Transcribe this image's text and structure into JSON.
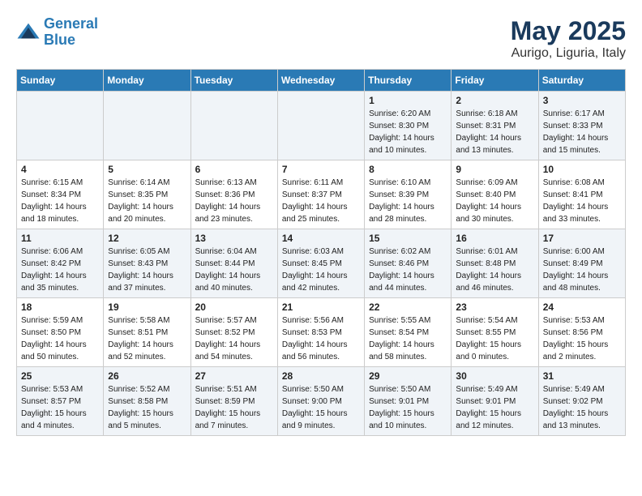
{
  "header": {
    "logo_line1": "General",
    "logo_line2": "Blue",
    "title": "May 2025",
    "subtitle": "Aurigo, Liguria, Italy"
  },
  "days_of_week": [
    "Sunday",
    "Monday",
    "Tuesday",
    "Wednesday",
    "Thursday",
    "Friday",
    "Saturday"
  ],
  "weeks": [
    [
      {
        "day": "",
        "info": ""
      },
      {
        "day": "",
        "info": ""
      },
      {
        "day": "",
        "info": ""
      },
      {
        "day": "",
        "info": ""
      },
      {
        "day": "1",
        "info": "Sunrise: 6:20 AM\nSunset: 8:30 PM\nDaylight: 14 hours\nand 10 minutes."
      },
      {
        "day": "2",
        "info": "Sunrise: 6:18 AM\nSunset: 8:31 PM\nDaylight: 14 hours\nand 13 minutes."
      },
      {
        "day": "3",
        "info": "Sunrise: 6:17 AM\nSunset: 8:33 PM\nDaylight: 14 hours\nand 15 minutes."
      }
    ],
    [
      {
        "day": "4",
        "info": "Sunrise: 6:15 AM\nSunset: 8:34 PM\nDaylight: 14 hours\nand 18 minutes."
      },
      {
        "day": "5",
        "info": "Sunrise: 6:14 AM\nSunset: 8:35 PM\nDaylight: 14 hours\nand 20 minutes."
      },
      {
        "day": "6",
        "info": "Sunrise: 6:13 AM\nSunset: 8:36 PM\nDaylight: 14 hours\nand 23 minutes."
      },
      {
        "day": "7",
        "info": "Sunrise: 6:11 AM\nSunset: 8:37 PM\nDaylight: 14 hours\nand 25 minutes."
      },
      {
        "day": "8",
        "info": "Sunrise: 6:10 AM\nSunset: 8:39 PM\nDaylight: 14 hours\nand 28 minutes."
      },
      {
        "day": "9",
        "info": "Sunrise: 6:09 AM\nSunset: 8:40 PM\nDaylight: 14 hours\nand 30 minutes."
      },
      {
        "day": "10",
        "info": "Sunrise: 6:08 AM\nSunset: 8:41 PM\nDaylight: 14 hours\nand 33 minutes."
      }
    ],
    [
      {
        "day": "11",
        "info": "Sunrise: 6:06 AM\nSunset: 8:42 PM\nDaylight: 14 hours\nand 35 minutes."
      },
      {
        "day": "12",
        "info": "Sunrise: 6:05 AM\nSunset: 8:43 PM\nDaylight: 14 hours\nand 37 minutes."
      },
      {
        "day": "13",
        "info": "Sunrise: 6:04 AM\nSunset: 8:44 PM\nDaylight: 14 hours\nand 40 minutes."
      },
      {
        "day": "14",
        "info": "Sunrise: 6:03 AM\nSunset: 8:45 PM\nDaylight: 14 hours\nand 42 minutes."
      },
      {
        "day": "15",
        "info": "Sunrise: 6:02 AM\nSunset: 8:46 PM\nDaylight: 14 hours\nand 44 minutes."
      },
      {
        "day": "16",
        "info": "Sunrise: 6:01 AM\nSunset: 8:48 PM\nDaylight: 14 hours\nand 46 minutes."
      },
      {
        "day": "17",
        "info": "Sunrise: 6:00 AM\nSunset: 8:49 PM\nDaylight: 14 hours\nand 48 minutes."
      }
    ],
    [
      {
        "day": "18",
        "info": "Sunrise: 5:59 AM\nSunset: 8:50 PM\nDaylight: 14 hours\nand 50 minutes."
      },
      {
        "day": "19",
        "info": "Sunrise: 5:58 AM\nSunset: 8:51 PM\nDaylight: 14 hours\nand 52 minutes."
      },
      {
        "day": "20",
        "info": "Sunrise: 5:57 AM\nSunset: 8:52 PM\nDaylight: 14 hours\nand 54 minutes."
      },
      {
        "day": "21",
        "info": "Sunrise: 5:56 AM\nSunset: 8:53 PM\nDaylight: 14 hours\nand 56 minutes."
      },
      {
        "day": "22",
        "info": "Sunrise: 5:55 AM\nSunset: 8:54 PM\nDaylight: 14 hours\nand 58 minutes."
      },
      {
        "day": "23",
        "info": "Sunrise: 5:54 AM\nSunset: 8:55 PM\nDaylight: 15 hours\nand 0 minutes."
      },
      {
        "day": "24",
        "info": "Sunrise: 5:53 AM\nSunset: 8:56 PM\nDaylight: 15 hours\nand 2 minutes."
      }
    ],
    [
      {
        "day": "25",
        "info": "Sunrise: 5:53 AM\nSunset: 8:57 PM\nDaylight: 15 hours\nand 4 minutes."
      },
      {
        "day": "26",
        "info": "Sunrise: 5:52 AM\nSunset: 8:58 PM\nDaylight: 15 hours\nand 5 minutes."
      },
      {
        "day": "27",
        "info": "Sunrise: 5:51 AM\nSunset: 8:59 PM\nDaylight: 15 hours\nand 7 minutes."
      },
      {
        "day": "28",
        "info": "Sunrise: 5:50 AM\nSunset: 9:00 PM\nDaylight: 15 hours\nand 9 minutes."
      },
      {
        "day": "29",
        "info": "Sunrise: 5:50 AM\nSunset: 9:01 PM\nDaylight: 15 hours\nand 10 minutes."
      },
      {
        "day": "30",
        "info": "Sunrise: 5:49 AM\nSunset: 9:01 PM\nDaylight: 15 hours\nand 12 minutes."
      },
      {
        "day": "31",
        "info": "Sunrise: 5:49 AM\nSunset: 9:02 PM\nDaylight: 15 hours\nand 13 minutes."
      }
    ]
  ]
}
